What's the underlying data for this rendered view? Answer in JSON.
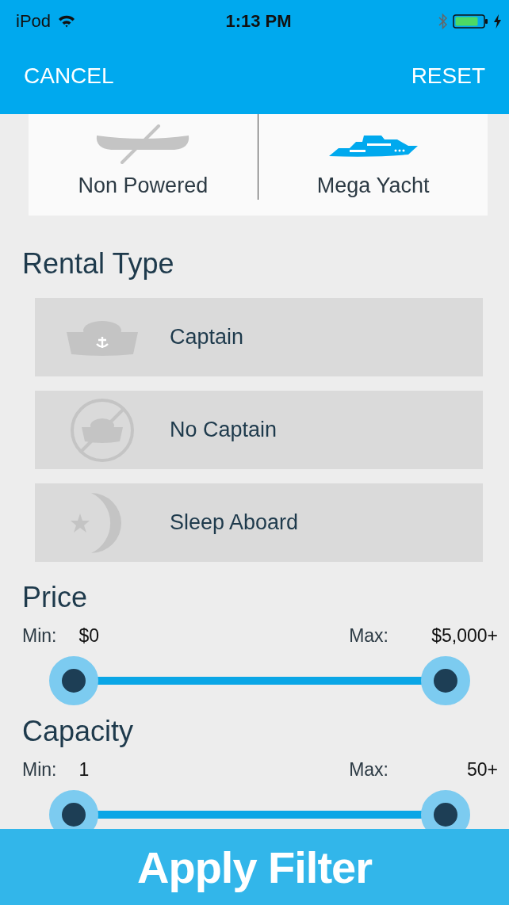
{
  "status_bar": {
    "carrier": "iPod",
    "time": "1:13 PM"
  },
  "nav": {
    "left": "CANCEL",
    "right": "RESET"
  },
  "boat_types": [
    {
      "label": "Non Powered",
      "kind": "canoe",
      "selected": false
    },
    {
      "label": "Mega Yacht",
      "kind": "yacht",
      "selected": true
    }
  ],
  "rental_type": {
    "title": "Rental Type",
    "options": [
      {
        "label": "Captain",
        "kind": "captain",
        "selected": false
      },
      {
        "label": "No Captain",
        "kind": "no_captain",
        "selected": false
      },
      {
        "label": "Sleep Aboard",
        "kind": "sleep",
        "selected": false
      }
    ]
  },
  "ranges": [
    {
      "title": "Price",
      "min_label": "Min:",
      "min_value": "$0",
      "max_label": "Max:",
      "max_value": "$5,000+",
      "thumbs": [
        {
          "level": 0
        },
        {
          "level": 1
        }
      ]
    },
    {
      "title": "Capacity",
      "min_label": "Min:",
      "min_value": "1",
      "max_label": "Max:",
      "max_value": "50+",
      "thumbs": [
        {
          "level": 0
        },
        {
          "level": 1
        }
      ]
    }
  ],
  "apply_button": "Apply Filter"
}
